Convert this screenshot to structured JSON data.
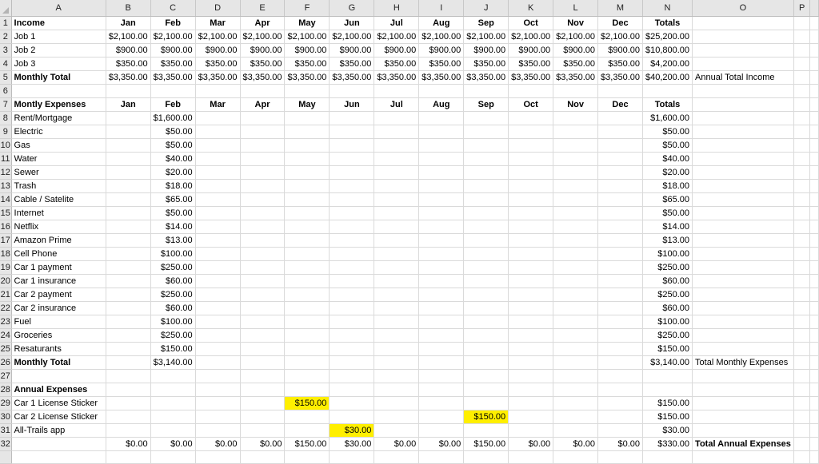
{
  "columns": [
    "A",
    "B",
    "C",
    "D",
    "E",
    "F",
    "G",
    "H",
    "I",
    "J",
    "K",
    "L",
    "M",
    "N",
    "O",
    "P",
    ""
  ],
  "rows": [
    {
      "n": "1",
      "cells": [
        "Income",
        "Jan",
        "Feb",
        "Mar",
        "Apr",
        "May",
        "Jun",
        "Jul",
        "Aug",
        "Sep",
        "Oct",
        "Nov",
        "Dec",
        "Totals",
        "",
        ""
      ]
    },
    {
      "n": "2",
      "cells": [
        "Job 1",
        "$2,100.00",
        "$2,100.00",
        "$2,100.00",
        "$2,100.00",
        "$2,100.00",
        "$2,100.00",
        "$2,100.00",
        "$2,100.00",
        "$2,100.00",
        "$2,100.00",
        "$2,100.00",
        "$2,100.00",
        "$25,200.00",
        "",
        ""
      ]
    },
    {
      "n": "3",
      "cells": [
        "Job 2",
        "$900.00",
        "$900.00",
        "$900.00",
        "$900.00",
        "$900.00",
        "$900.00",
        "$900.00",
        "$900.00",
        "$900.00",
        "$900.00",
        "$900.00",
        "$900.00",
        "$10,800.00",
        "",
        ""
      ]
    },
    {
      "n": "4",
      "cells": [
        "Job 3",
        "$350.00",
        "$350.00",
        "$350.00",
        "$350.00",
        "$350.00",
        "$350.00",
        "$350.00",
        "$350.00",
        "$350.00",
        "$350.00",
        "$350.00",
        "$350.00",
        "$4,200.00",
        "",
        ""
      ]
    },
    {
      "n": "5",
      "cells": [
        "Monthly Total",
        "$3,350.00",
        "$3,350.00",
        "$3,350.00",
        "$3,350.00",
        "$3,350.00",
        "$3,350.00",
        "$3,350.00",
        "$3,350.00",
        "$3,350.00",
        "$3,350.00",
        "$3,350.00",
        "$3,350.00",
        "$40,200.00",
        "Annual Total Income",
        ""
      ]
    },
    {
      "n": "6",
      "cells": [
        "",
        "",
        "",
        "",
        "",
        "",
        "",
        "",
        "",
        "",
        "",
        "",
        "",
        "",
        "",
        ""
      ]
    },
    {
      "n": "7",
      "cells": [
        "Montly Expenses",
        "Jan",
        "Feb",
        "Mar",
        "Apr",
        "May",
        "Jun",
        "Jul",
        "Aug",
        "Sep",
        "Oct",
        "Nov",
        "Dec",
        "Totals",
        "",
        ""
      ]
    },
    {
      "n": "8",
      "cells": [
        "Rent/Mortgage",
        "",
        "$1,600.00",
        "",
        "",
        "",
        "",
        "",
        "",
        "",
        "",
        "",
        "",
        "$1,600.00",
        "",
        ""
      ]
    },
    {
      "n": "9",
      "cells": [
        "Electric",
        "",
        "$50.00",
        "",
        "",
        "",
        "",
        "",
        "",
        "",
        "",
        "",
        "",
        "$50.00",
        "",
        ""
      ]
    },
    {
      "n": "10",
      "cells": [
        "Gas",
        "",
        "$50.00",
        "",
        "",
        "",
        "",
        "",
        "",
        "",
        "",
        "",
        "",
        "$50.00",
        "",
        ""
      ]
    },
    {
      "n": "11",
      "cells": [
        "Water",
        "",
        "$40.00",
        "",
        "",
        "",
        "",
        "",
        "",
        "",
        "",
        "",
        "",
        "$40.00",
        "",
        ""
      ]
    },
    {
      "n": "12",
      "cells": [
        "Sewer",
        "",
        "$20.00",
        "",
        "",
        "",
        "",
        "",
        "",
        "",
        "",
        "",
        "",
        "$20.00",
        "",
        ""
      ]
    },
    {
      "n": "13",
      "cells": [
        "Trash",
        "",
        "$18.00",
        "",
        "",
        "",
        "",
        "",
        "",
        "",
        "",
        "",
        "",
        "$18.00",
        "",
        ""
      ]
    },
    {
      "n": "14",
      "cells": [
        "Cable / Satelite",
        "",
        "$65.00",
        "",
        "",
        "",
        "",
        "",
        "",
        "",
        "",
        "",
        "",
        "$65.00",
        "",
        ""
      ]
    },
    {
      "n": "15",
      "cells": [
        "Internet",
        "",
        "$50.00",
        "",
        "",
        "",
        "",
        "",
        "",
        "",
        "",
        "",
        "",
        "$50.00",
        "",
        ""
      ]
    },
    {
      "n": "16",
      "cells": [
        "Netflix",
        "",
        "$14.00",
        "",
        "",
        "",
        "",
        "",
        "",
        "",
        "",
        "",
        "",
        "$14.00",
        "",
        ""
      ]
    },
    {
      "n": "17",
      "cells": [
        "Amazon Prime",
        "",
        "$13.00",
        "",
        "",
        "",
        "",
        "",
        "",
        "",
        "",
        "",
        "",
        "$13.00",
        "",
        ""
      ]
    },
    {
      "n": "18",
      "cells": [
        "Cell Phone",
        "",
        "$100.00",
        "",
        "",
        "",
        "",
        "",
        "",
        "",
        "",
        "",
        "",
        "$100.00",
        "",
        ""
      ]
    },
    {
      "n": "19",
      "cells": [
        "Car 1 payment",
        "",
        "$250.00",
        "",
        "",
        "",
        "",
        "",
        "",
        "",
        "",
        "",
        "",
        "$250.00",
        "",
        ""
      ]
    },
    {
      "n": "20",
      "cells": [
        "Car 1 insurance",
        "",
        "$60.00",
        "",
        "",
        "",
        "",
        "",
        "",
        "",
        "",
        "",
        "",
        "$60.00",
        "",
        ""
      ]
    },
    {
      "n": "21",
      "cells": [
        "Car 2 payment",
        "",
        "$250.00",
        "",
        "",
        "",
        "",
        "",
        "",
        "",
        "",
        "",
        "",
        "$250.00",
        "",
        ""
      ]
    },
    {
      "n": "22",
      "cells": [
        "Car 2 insurance",
        "",
        "$60.00",
        "",
        "",
        "",
        "",
        "",
        "",
        "",
        "",
        "",
        "",
        "$60.00",
        "",
        ""
      ]
    },
    {
      "n": "23",
      "cells": [
        "Fuel",
        "",
        "$100.00",
        "",
        "",
        "",
        "",
        "",
        "",
        "",
        "",
        "",
        "",
        "$100.00",
        "",
        ""
      ]
    },
    {
      "n": "24",
      "cells": [
        "Groceries",
        "",
        "$250.00",
        "",
        "",
        "",
        "",
        "",
        "",
        "",
        "",
        "",
        "",
        "$250.00",
        "",
        ""
      ]
    },
    {
      "n": "25",
      "cells": [
        "Resaturants",
        "",
        "$150.00",
        "",
        "",
        "",
        "",
        "",
        "",
        "",
        "",
        "",
        "",
        "$150.00",
        "",
        ""
      ]
    },
    {
      "n": "26",
      "cells": [
        "Monthly Total",
        "",
        "$3,140.00",
        "",
        "",
        "",
        "",
        "",
        "",
        "",
        "",
        "",
        "",
        "$3,140.00",
        "Total Monthly Expenses",
        ""
      ]
    },
    {
      "n": "27",
      "cells": [
        "",
        "",
        "",
        "",
        "",
        "",
        "",
        "",
        "",
        "",
        "",
        "",
        "",
        "",
        "",
        ""
      ]
    },
    {
      "n": "28",
      "cells": [
        "Annual Expenses",
        "",
        "",
        "",
        "",
        "",
        "",
        "",
        "",
        "",
        "",
        "",
        "",
        "",
        "",
        ""
      ]
    },
    {
      "n": "29",
      "cells": [
        "Car 1 License Sticker",
        "",
        "",
        "",
        "",
        "$150.00",
        "",
        "",
        "",
        "",
        "",
        "",
        "",
        "$150.00",
        "",
        ""
      ]
    },
    {
      "n": "30",
      "cells": [
        "Car 2 License Sticker",
        "",
        "",
        "",
        "",
        "",
        "",
        "",
        "",
        "$150.00",
        "",
        "",
        "",
        "$150.00",
        "",
        ""
      ]
    },
    {
      "n": "31",
      "cells": [
        "All-Trails app",
        "",
        "",
        "",
        "",
        "",
        "$30.00",
        "",
        "",
        "",
        "",
        "",
        "",
        "$30.00",
        "",
        ""
      ]
    },
    {
      "n": "32",
      "cells": [
        "",
        "$0.00",
        "$0.00",
        "$0.00",
        "$0.00",
        "$150.00",
        "$30.00",
        "$0.00",
        "$0.00",
        "$150.00",
        "$0.00",
        "$0.00",
        "$0.00",
        "$330.00",
        "Total Annual Expenses",
        ""
      ]
    },
    {
      "n": "",
      "cells": [
        "",
        "",
        "",
        "",
        "",
        "",
        "",
        "",
        "",
        "",
        "",
        "",
        "",
        "",
        "",
        ""
      ]
    }
  ],
  "bold_rows": [
    "1",
    "5",
    "7",
    "26",
    "28"
  ],
  "highlighted_cells": [
    "F29",
    "J30",
    "G31"
  ],
  "highlight_color": "#ffef00"
}
